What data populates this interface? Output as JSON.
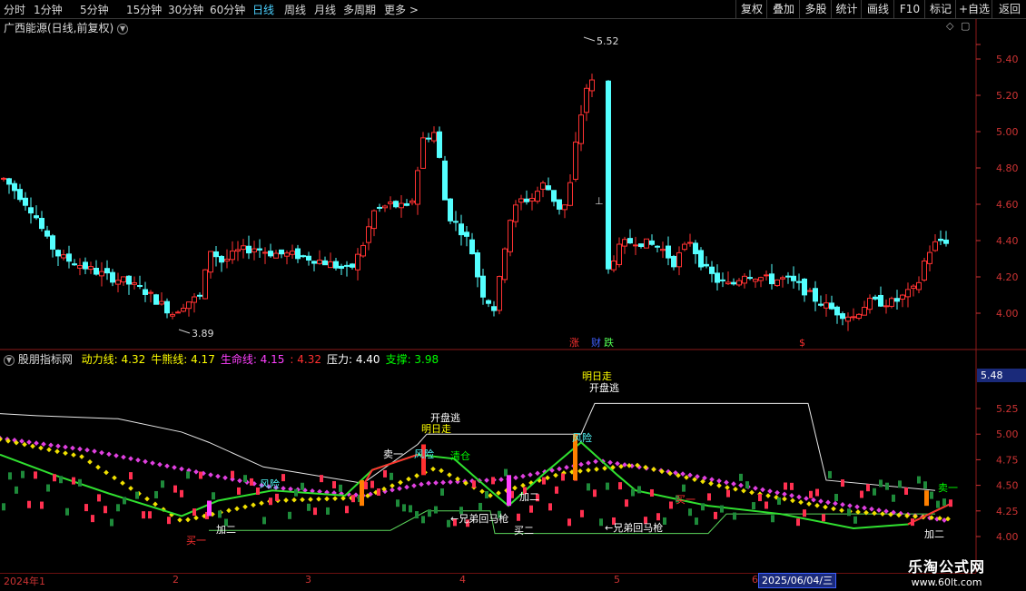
{
  "toolbar": {
    "periods": [
      "分时",
      "1分钟",
      "5分钟",
      "15分钟",
      "30分钟",
      "60分钟",
      "日线",
      "周线",
      "月线",
      "多周期",
      "更多 >"
    ],
    "active_period": "日线",
    "right_buttons": [
      "复权",
      "叠加",
      "多股",
      "统计",
      "画线",
      "F10",
      "标记",
      "+自选",
      "返回"
    ]
  },
  "main_panel": {
    "title": "广西能源(日线,前复权)",
    "y_ticks": [
      "5.40",
      "5.20",
      "5.00",
      "4.80",
      "4.60",
      "4.40",
      "4.20",
      "4.00"
    ],
    "high_label": "5.52",
    "low_label": "3.89",
    "events": [
      "涨",
      "财",
      "跌",
      "$"
    ]
  },
  "indicator_panel": {
    "name": "股朋指标网",
    "lines": [
      {
        "label": "动力线:",
        "value": "4.32",
        "color": "#ffff00"
      },
      {
        "label": "牛熊线:",
        "value": "4.17",
        "color": "#ffff00"
      },
      {
        "label": "生命线:",
        "value": "4.15",
        "color": "#ff40ff"
      },
      {
        "label": ":",
        "value": "4.32",
        "color": "#ff3030"
      },
      {
        "label": "压力:",
        "value": "4.40",
        "color": "#ffffff"
      },
      {
        "label": "支撑:",
        "value": "3.98",
        "color": "#00ff00"
      }
    ],
    "y_ticks": [
      "5.25",
      "5.00",
      "4.75",
      "4.50",
      "4.25",
      "4.00"
    ],
    "current_value": "5.48",
    "signals": [
      "买一",
      "加二",
      "风险",
      "卖一",
      "风险",
      "明日走",
      "开盘逃",
      "清仓",
      "←兄弟回马枪",
      "买二",
      "加二",
      "明日走",
      "开盘逃",
      "风险",
      "买一",
      "←兄弟回马枪",
      "卖一",
      "加二"
    ]
  },
  "time_axis": {
    "labels": [
      "2024年1",
      "2",
      "3",
      "4",
      "5",
      "6"
    ],
    "cursor_date": "2025/06/04/三"
  },
  "watermark": {
    "title": "乐淘公式网",
    "url": "www.60lt.com"
  }
}
